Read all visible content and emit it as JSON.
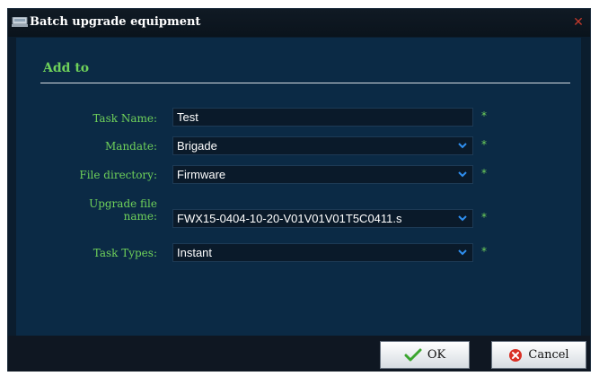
{
  "window": {
    "title": "Batch upgrade equipment"
  },
  "section": {
    "title": "Add to"
  },
  "form": {
    "task_name": {
      "label": "Task Name:",
      "value": "Test"
    },
    "mandate": {
      "label": "Mandate:",
      "value": "Brigade"
    },
    "file_directory": {
      "label": "File directory:",
      "value": "Firmware"
    },
    "upgrade_file_name": {
      "label_line1": "Upgrade file",
      "label_line2": "name:",
      "value": "FWX15-0404-10-20-V01V01V01T5C0411.s"
    },
    "task_types": {
      "label": "Task Types:",
      "value": "Instant"
    },
    "required_marker": "*"
  },
  "buttons": {
    "ok": "OK",
    "cancel": "Cancel"
  },
  "colors": {
    "accent_green": "#6fd15a",
    "panel_bg": "#0b2a45",
    "close_red": "#c0392b"
  },
  "icons": {
    "title": "network-device-icon",
    "close": "close-icon",
    "ok": "checkmark-icon",
    "cancel": "cancel-x-icon",
    "dropdown": "chevron-down-icon"
  }
}
